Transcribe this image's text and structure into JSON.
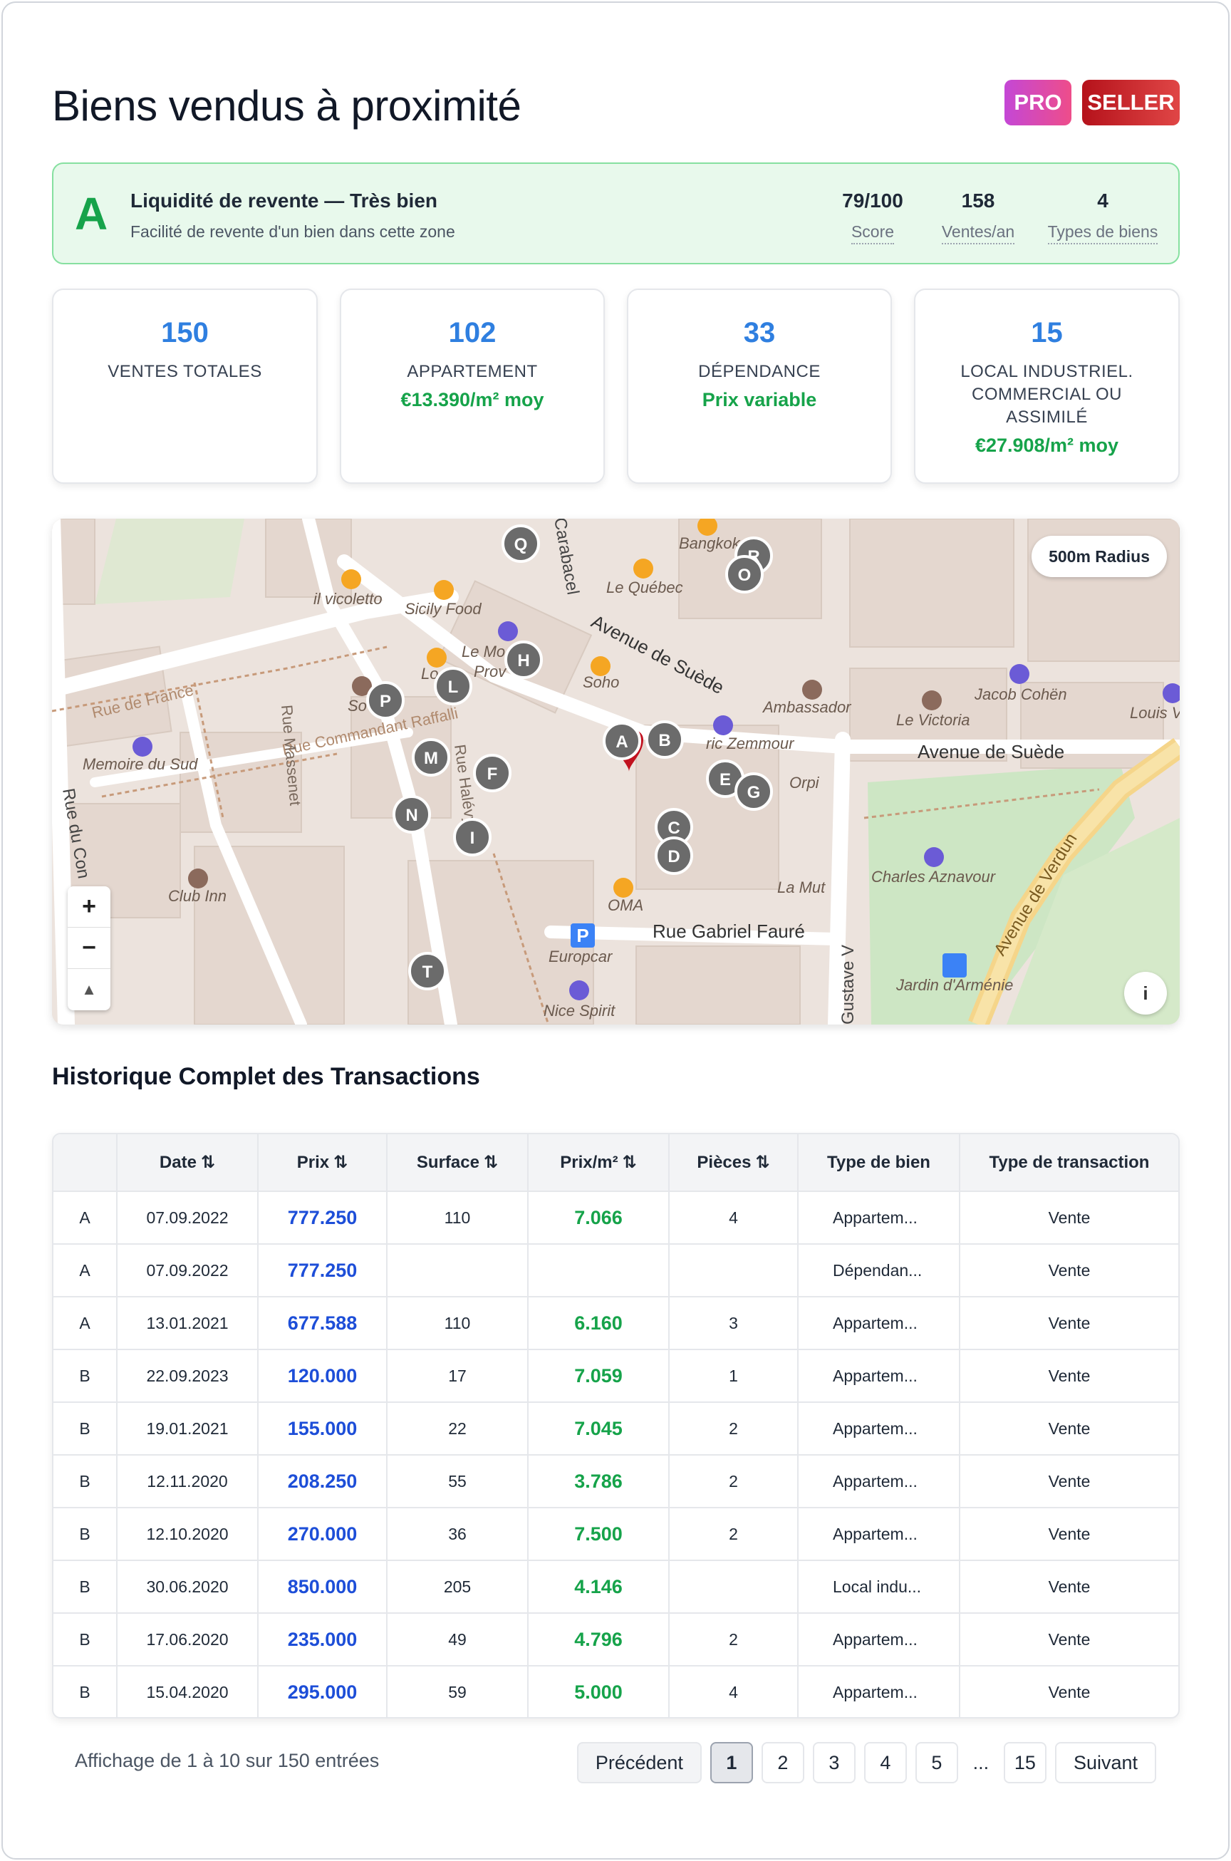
{
  "header": {
    "title": "Biens vendus à proximité",
    "badges": {
      "pro": "PRO",
      "seller": "SELLER"
    }
  },
  "liquidity": {
    "grade": "A",
    "title": "Liquidité de revente — Très bien",
    "subtitle": "Facilité de revente d'un bien dans cette zone",
    "stats": [
      {
        "value": "79/100",
        "label": "Score"
      },
      {
        "value": "158",
        "label": "Ventes/an"
      },
      {
        "value": "4",
        "label": "Types de biens"
      }
    ]
  },
  "cards": [
    {
      "number": "150",
      "label": "VENTES TOTALES",
      "sub": ""
    },
    {
      "number": "102",
      "label": "APPARTEMENT",
      "sub": "€13.390/m² moy"
    },
    {
      "number": "33",
      "label": "DÉPENDANCE",
      "sub": "Prix variable"
    },
    {
      "number": "15",
      "label": "LOCAL INDUSTRIEL. COMMERCIAL OU ASSIMILÉ",
      "sub": "€27.908/m² moy"
    }
  ],
  "map": {
    "radius_button": "500m Radius",
    "zoom_in": "+",
    "zoom_out": "−",
    "compass": "▲",
    "info": "i",
    "streets": {
      "rue_de_france": "Rue de France",
      "rue_massenet": "Rue Massenet",
      "rue_commandant": "Rue Commandant Raffalli",
      "rue_halevy": "Rue Halévy",
      "avenue_suede_diag": "Avenue de Suède",
      "avenue_suede": "Avenue de Suède",
      "rue_gabriel_faure": "Rue Gabriel Fauré",
      "avenue_verdun": "Avenue de Verdun",
      "rue_du_con": "Rue du Con",
      "carabacel": "Carabacel",
      "gustave_v": "Gustave V"
    },
    "pois": {
      "bangkok": "Bangkok",
      "le_quebec": "Le Québec",
      "il_vicoletto": "il vicoletto",
      "sicily_food": "Sicily Food",
      "le_mo_le": "Le Mo    le",
      "prov": "Prov",
      "lo": "Lo",
      "soho": "Soho",
      "ambassador": "Ambassador",
      "le_victoria": "Le Victoria",
      "jacob_cohen": "Jacob Cohën",
      "louis_v": "Louis V",
      "memoire_du_sud": "Memoire du Sud",
      "zemmour": "ric Zemmour",
      "orpi": "Orpi",
      "charles_aznavour": "Charles Aznavour",
      "la_mut": "La Mut",
      "oma": "OMA",
      "club_inn": "Club Inn",
      "europcar": "Europcar",
      "nice_spirit": "Nice Spirit",
      "jardin_armenie": "Jardin d'Arménie",
      "so": "So"
    },
    "markers": [
      "A",
      "B",
      "C",
      "D",
      "E",
      "F",
      "G",
      "H",
      "I",
      "L",
      "M",
      "N",
      "P",
      "Q",
      "R",
      "T",
      "O"
    ]
  },
  "history": {
    "title": "Historique Complet des Transactions",
    "columns": [
      "",
      "Date",
      "Prix",
      "Surface",
      "Prix/m²",
      "Pièces",
      "Type de bien",
      "Type de transaction"
    ],
    "sort_glyph": "⇅",
    "rows": [
      {
        "marker": "A",
        "date": "07.09.2022",
        "price": "777.250",
        "surface": "110",
        "ppm": "7.066",
        "rooms": "4",
        "type": "Appartem...",
        "transaction": "Vente"
      },
      {
        "marker": "A",
        "date": "07.09.2022",
        "price": "777.250",
        "surface": "",
        "ppm": "",
        "rooms": "",
        "type": "Dépendan...",
        "transaction": "Vente"
      },
      {
        "marker": "A",
        "date": "13.01.2021",
        "price": "677.588",
        "surface": "110",
        "ppm": "6.160",
        "rooms": "3",
        "type": "Appartem...",
        "transaction": "Vente"
      },
      {
        "marker": "B",
        "date": "22.09.2023",
        "price": "120.000",
        "surface": "17",
        "ppm": "7.059",
        "rooms": "1",
        "type": "Appartem...",
        "transaction": "Vente"
      },
      {
        "marker": "B",
        "date": "19.01.2021",
        "price": "155.000",
        "surface": "22",
        "ppm": "7.045",
        "rooms": "2",
        "type": "Appartem...",
        "transaction": "Vente"
      },
      {
        "marker": "B",
        "date": "12.11.2020",
        "price": "208.250",
        "surface": "55",
        "ppm": "3.786",
        "rooms": "2",
        "type": "Appartem...",
        "transaction": "Vente"
      },
      {
        "marker": "B",
        "date": "12.10.2020",
        "price": "270.000",
        "surface": "36",
        "ppm": "7.500",
        "rooms": "2",
        "type": "Appartem...",
        "transaction": "Vente"
      },
      {
        "marker": "B",
        "date": "30.06.2020",
        "price": "850.000",
        "surface": "205",
        "ppm": "4.146",
        "rooms": "",
        "type": "Local indu...",
        "transaction": "Vente"
      },
      {
        "marker": "B",
        "date": "17.06.2020",
        "price": "235.000",
        "surface": "49",
        "ppm": "4.796",
        "rooms": "2",
        "type": "Appartem...",
        "transaction": "Vente"
      },
      {
        "marker": "B",
        "date": "15.04.2020",
        "price": "295.000",
        "surface": "59",
        "ppm": "5.000",
        "rooms": "4",
        "type": "Appartem...",
        "transaction": "Vente"
      }
    ]
  },
  "pagination": {
    "summary": "Affichage de 1 à 10 sur 150 entrées",
    "prev": "Précédent",
    "next": "Suivant",
    "pages": [
      "1",
      "2",
      "3",
      "4",
      "5"
    ],
    "ellipsis": "...",
    "last": "15",
    "current": "1"
  },
  "colors": {
    "accent_blue": "#2f7fe0",
    "price_blue": "#1d4ed8",
    "green": "#16a34a",
    "liquidity_bg": "#e8f9ec",
    "marker_gray": "#6b6b6b",
    "pin_red": "#c1121f"
  }
}
